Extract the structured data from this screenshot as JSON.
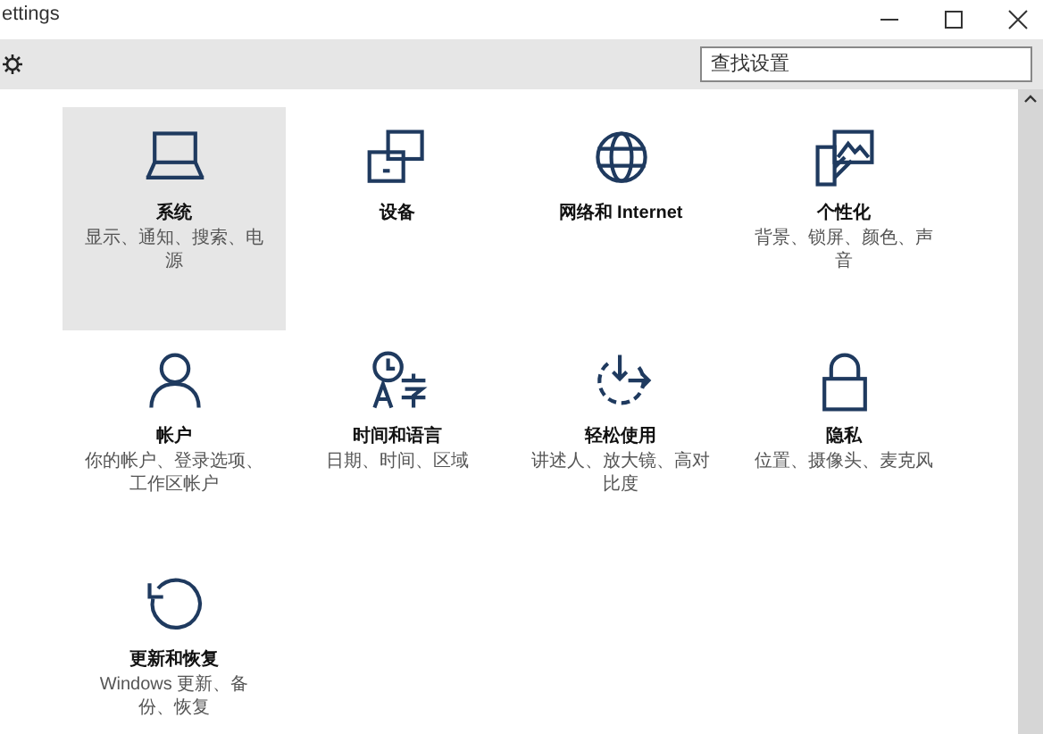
{
  "window": {
    "title": "ettings"
  },
  "search": {
    "placeholder": "查找设置"
  },
  "tiles": [
    {
      "title": "系统",
      "subtitle": "显示、通知、搜索、电源",
      "selected": true
    },
    {
      "title": "设备",
      "selected": false
    },
    {
      "title": "网络和 Internet",
      "selected": false
    },
    {
      "title": "个性化",
      "subtitle": "背景、锁屏、颜色、声音",
      "selected": false
    },
    {
      "title": "帐户",
      "subtitle": "你的帐户、登录选项、工作区帐户",
      "selected": false
    },
    {
      "title": "时间和语言",
      "subtitle": "日期、时间、区域",
      "selected": false
    },
    {
      "title": "轻松使用",
      "subtitle": "讲述人、放大镜、高对比度",
      "selected": false
    },
    {
      "title": "隐私",
      "subtitle": "位置、摄像头、麦克风",
      "selected": false
    },
    {
      "title": "更新和恢复",
      "subtitle": "Windows 更新、备份、恢复",
      "selected": false
    }
  ]
}
